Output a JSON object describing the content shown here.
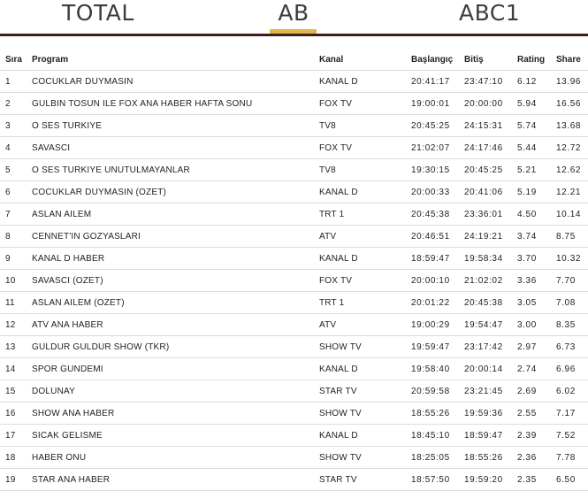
{
  "tabs": [
    {
      "label": "TOTAL",
      "active": false
    },
    {
      "label": "AB",
      "active": true
    },
    {
      "label": "ABC1",
      "active": false
    }
  ],
  "accent_color": "#e2b44c",
  "divider_color": "#3f1d1a",
  "table": {
    "headers": {
      "sira": "Sıra",
      "program": "Program",
      "kanal": "Kanal",
      "baslangic": "Başlangıç",
      "bitis": "Bitiş",
      "rating": "Rating",
      "share": "Share"
    },
    "rows": [
      {
        "sira": "1",
        "program": "COCUKLAR DUYMASIN",
        "kanal": "KANAL D",
        "baslangic": "20:41:17",
        "bitis": "23:47:10",
        "rating": "6.12",
        "share": "13.96"
      },
      {
        "sira": "2",
        "program": "GULBIN TOSUN ILE FOX ANA HABER HAFTA SONU",
        "kanal": "FOX TV",
        "baslangic": "19:00:01",
        "bitis": "20:00:00",
        "rating": "5.94",
        "share": "16.56"
      },
      {
        "sira": "3",
        "program": "O SES TURKIYE",
        "kanal": "TV8",
        "baslangic": "20:45:25",
        "bitis": "24:15:31",
        "rating": "5.74",
        "share": "13.68"
      },
      {
        "sira": "4",
        "program": "SAVASCI",
        "kanal": "FOX TV",
        "baslangic": "21:02:07",
        "bitis": "24:17:46",
        "rating": "5.44",
        "share": "12.72"
      },
      {
        "sira": "5",
        "program": "O SES TURKIYE UNUTULMAYANLAR",
        "kanal": "TV8",
        "baslangic": "19:30:15",
        "bitis": "20:45:25",
        "rating": "5.21",
        "share": "12.62"
      },
      {
        "sira": "6",
        "program": "COCUKLAR DUYMASIN (OZET)",
        "kanal": "KANAL D",
        "baslangic": "20:00:33",
        "bitis": "20:41:06",
        "rating": "5.19",
        "share": "12.21"
      },
      {
        "sira": "7",
        "program": "ASLAN AILEM",
        "kanal": "TRT 1",
        "baslangic": "20:45:38",
        "bitis": "23:36:01",
        "rating": "4.50",
        "share": "10.14"
      },
      {
        "sira": "8",
        "program": "CENNET'IN GOZYASLARI",
        "kanal": "ATV",
        "baslangic": "20:46:51",
        "bitis": "24:19:21",
        "rating": "3.74",
        "share": "8.75"
      },
      {
        "sira": "9",
        "program": "KANAL D HABER",
        "kanal": "KANAL D",
        "baslangic": "18:59:47",
        "bitis": "19:58:34",
        "rating": "3.70",
        "share": "10.32"
      },
      {
        "sira": "10",
        "program": "SAVASCI (OZET)",
        "kanal": "FOX TV",
        "baslangic": "20:00:10",
        "bitis": "21:02:02",
        "rating": "3.36",
        "share": "7.70"
      },
      {
        "sira": "11",
        "program": "ASLAN AILEM (OZET)",
        "kanal": "TRT 1",
        "baslangic": "20:01:22",
        "bitis": "20:45:38",
        "rating": "3.05",
        "share": "7.08"
      },
      {
        "sira": "12",
        "program": "ATV ANA HABER",
        "kanal": "ATV",
        "baslangic": "19:00:29",
        "bitis": "19:54:47",
        "rating": "3.00",
        "share": "8.35"
      },
      {
        "sira": "13",
        "program": "GULDUR GULDUR SHOW (TKR)",
        "kanal": "SHOW TV",
        "baslangic": "19:59:47",
        "bitis": "23:17:42",
        "rating": "2.97",
        "share": "6.73"
      },
      {
        "sira": "14",
        "program": "SPOR GUNDEMI",
        "kanal": "KANAL D",
        "baslangic": "19:58:40",
        "bitis": "20:00:14",
        "rating": "2.74",
        "share": "6.96"
      },
      {
        "sira": "15",
        "program": "DOLUNAY",
        "kanal": "STAR TV",
        "baslangic": "20:59:58",
        "bitis": "23:21:45",
        "rating": "2.69",
        "share": "6.02"
      },
      {
        "sira": "16",
        "program": "SHOW ANA HABER",
        "kanal": "SHOW TV",
        "baslangic": "18:55:26",
        "bitis": "19:59:36",
        "rating": "2.55",
        "share": "7.17"
      },
      {
        "sira": "17",
        "program": "SICAK GELISME",
        "kanal": "KANAL D",
        "baslangic": "18:45:10",
        "bitis": "18:59:47",
        "rating": "2.39",
        "share": "7.52"
      },
      {
        "sira": "18",
        "program": "HABER ONU",
        "kanal": "SHOW TV",
        "baslangic": "18:25:05",
        "bitis": "18:55:26",
        "rating": "2.36",
        "share": "7.78"
      },
      {
        "sira": "19",
        "program": "STAR ANA HABER",
        "kanal": "STAR TV",
        "baslangic": "18:57:50",
        "bitis": "19:59:20",
        "rating": "2.35",
        "share": "6.50"
      }
    ]
  }
}
